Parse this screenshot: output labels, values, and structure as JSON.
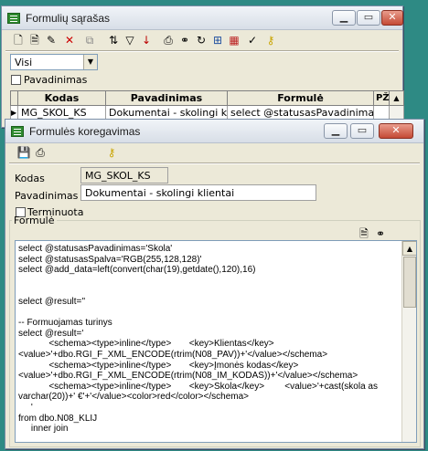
{
  "list_window": {
    "title": "Formulių sąrašas",
    "toolbar_icons": [
      "new-doc-icon",
      "open-doc-icon",
      "edit-icon",
      "delete-icon",
      "copy-icon",
      "sort-icon",
      "filter-icon",
      "sort-az-icon",
      "print-icon",
      "search-binoculars-icon",
      "refresh-icon",
      "tree-icon",
      "calendar-icon",
      "check-icon",
      "key-icon"
    ],
    "filter_combo": "Visi",
    "pavadinimas_checkbox_label": "Pavadinimas",
    "table": {
      "columns": [
        "Kodas",
        "Pavadinimas",
        "Formulė",
        "PŽ"
      ],
      "rows": [
        {
          "kodas": "MG_SKOL_KS",
          "pavadinimas": "Dokumentai - skolingi klientai",
          "formule": "select @statusasPavadinimas='Skc"
        }
      ]
    }
  },
  "edit_window": {
    "title": "Formulės koregavimas",
    "toolbar_icons": [
      "save-icon",
      "print-icon",
      "key-icon"
    ],
    "kodas_label": "Kodas",
    "kodas_value": "MG_SKOL_KS",
    "pavadinimas_label": "Pavadinimas",
    "pavadinimas_value": "Dokumentai - skolingi klientai",
    "terminuota_label": "Terminuota",
    "formule_group_label": "Formulė",
    "formule_lines": [
      "select @statusasPavadinimas='Skola'",
      "select @statusasSpalva='RGB(255,128,128)'",
      "select @add_data=left(convert(char(19),getdate(),120),16)",
      "",
      "",
      "select @result=''",
      "",
      "-- Formuojamas turinys",
      "select @result='",
      "            <schema><type>inline</type>       <key>Klientas</key>",
      "<value>'+dbo.RGI_F_XML_ENCODE(rtrim(N08_PAV))+'</value></schema>",
      "            <schema><type>inline</type>       <key>Įmonės kodas</key>",
      "<value>'+dbo.RGI_F_XML_ENCODE(rtrim(N08_IM_KODAS))+'</value></schema>",
      "            <schema><type>inline</type>       <key>Skola</key>        <value>'+cast(skola as",
      "varchar(20))+' €'+'</value><color>red</color></schema>",
      "     '",
      "from dbo.N08_KLIJ",
      "     inner join"
    ]
  }
}
